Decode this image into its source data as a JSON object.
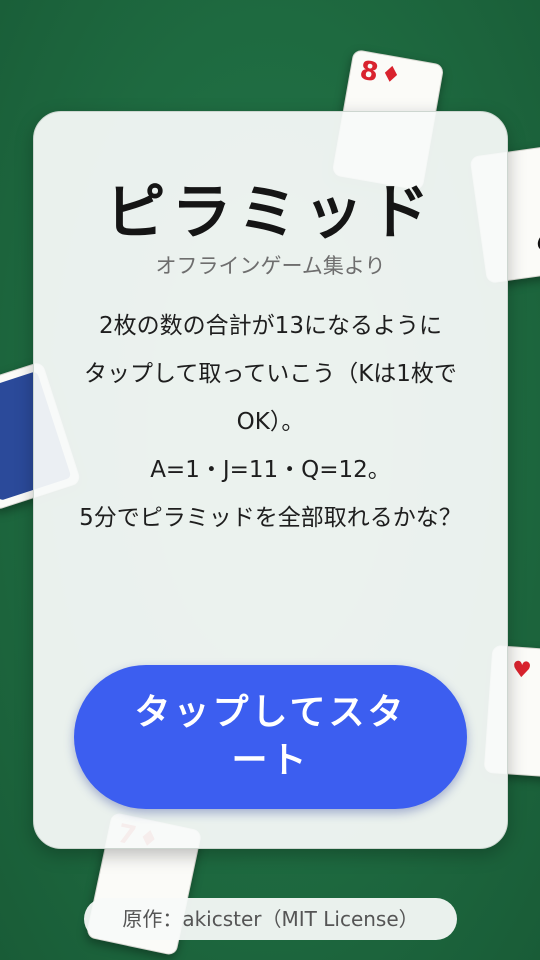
{
  "background_cards": [
    {
      "rank": "8",
      "suit": "♦",
      "color": "#d9232e"
    },
    {
      "rank": "",
      "suit": "♠",
      "color": "#111111"
    },
    {
      "rank": "",
      "suit": "♥",
      "color": "#d9232e"
    },
    {
      "rank": "7",
      "suit": "♦",
      "color": "#d9232e"
    }
  ],
  "title": "ピラミッド",
  "subtitle": "オフラインゲーム集より",
  "rules": [
    "2枚の数の合計が13になるように",
    "タップして取っていこう（Kは1枚でOK）。",
    "A=1・J=11・Q=12。",
    "5分でピラミッドを全部取れるかな？"
  ],
  "start_button_label": "タップしてスタート",
  "credit": "原作：akicster（MIT License）",
  "colors": {
    "felt": "#1f6b3f",
    "button": "#3c5ef0",
    "red_suit": "#d9232e"
  }
}
